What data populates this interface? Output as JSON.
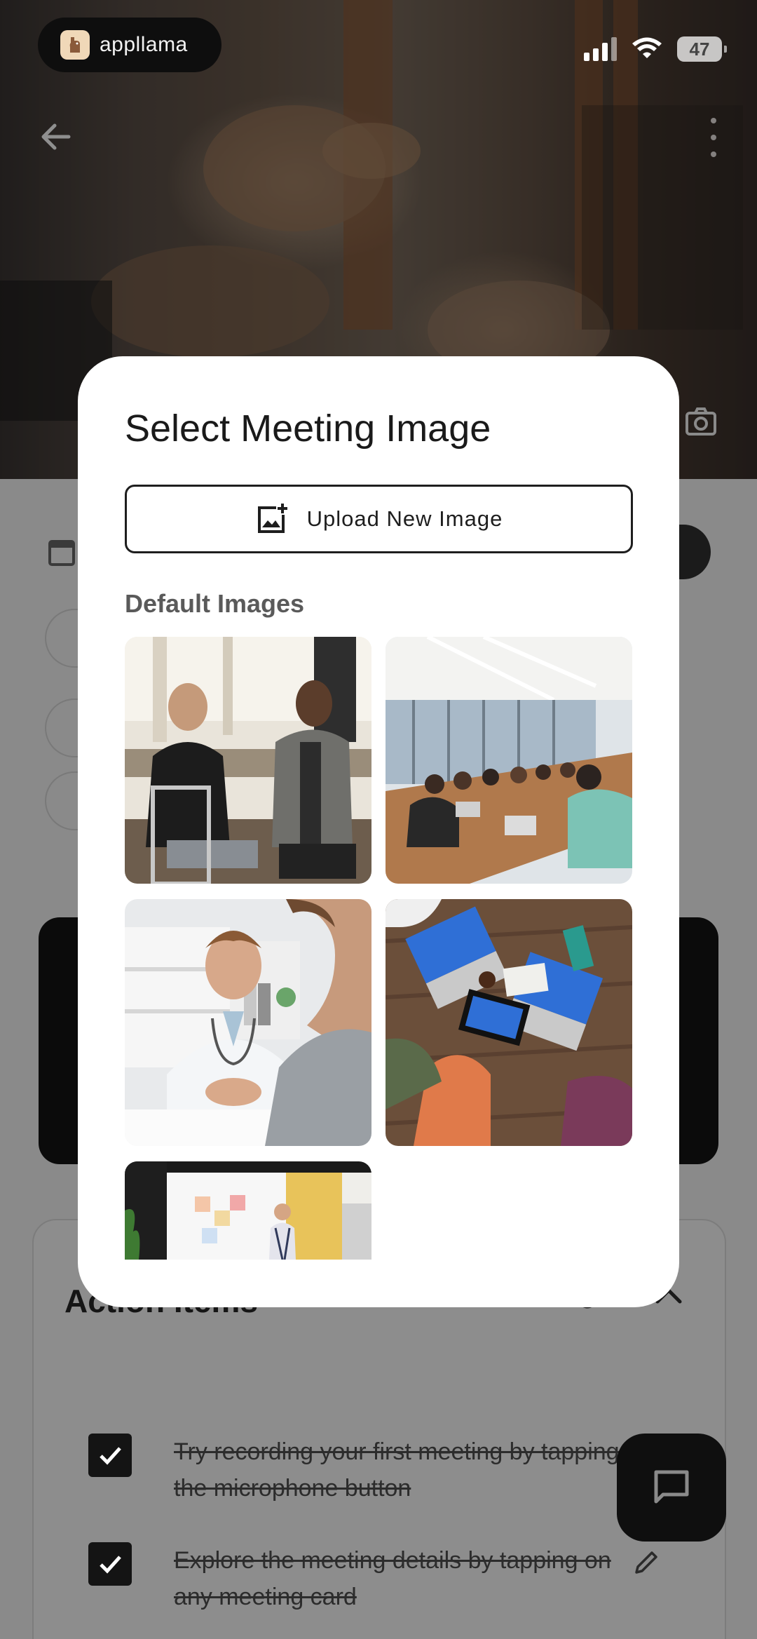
{
  "status_bar": {
    "brand": "appllama",
    "battery": "47"
  },
  "modal": {
    "title": "Select Meeting Image",
    "upload_label": "Upload New Image",
    "section_label": "Default Images",
    "images": [
      {
        "name": "two-people-casual-conversation"
      },
      {
        "name": "conference-room-meeting"
      },
      {
        "name": "doctor-patient-consultation"
      },
      {
        "name": "overhead-laptops-table"
      },
      {
        "name": "whiteboard-presentation"
      }
    ]
  },
  "background": {
    "action_items_title": "Action Items",
    "todos": [
      {
        "text": "Try recording your first meeting by tapping the microphone button",
        "done": true
      },
      {
        "text": "Explore the meeting details by tapping on any meeting card",
        "done": true
      }
    ]
  }
}
